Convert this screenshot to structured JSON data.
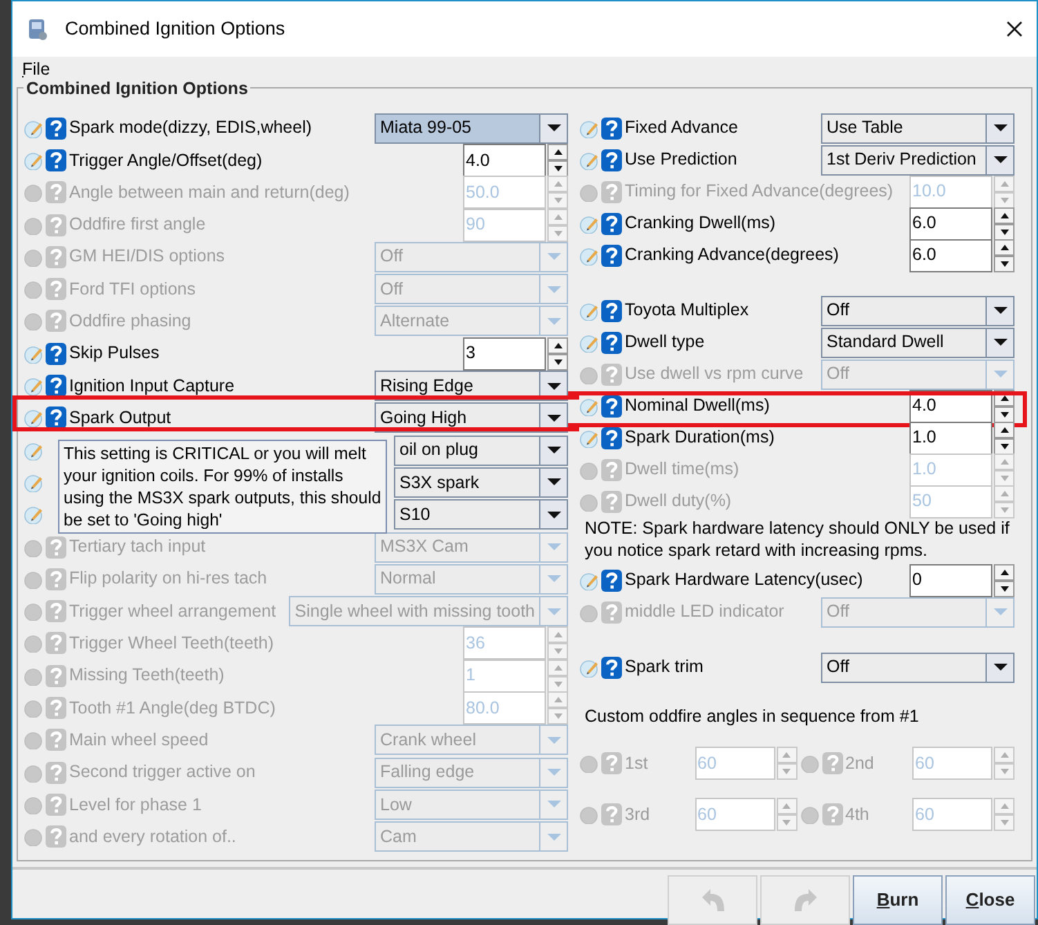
{
  "window": {
    "title": "Combined Ignition Options"
  },
  "menu": [
    {
      "label": "File",
      "underline_first": true
    }
  ],
  "group": {
    "title": "Combined Ignition Options"
  },
  "left_rows": [
    {
      "label": "Spark mode(dizzy, EDIS,wheel)",
      "kind": "combo",
      "value": "Miata 99-05",
      "disabled": false,
      "focused": true,
      "highlighted": false
    },
    {
      "label": "Trigger Angle/Offset(deg)",
      "kind": "spin",
      "value": "4.0",
      "disabled": false,
      "focused": false,
      "highlighted": false
    },
    {
      "label": "Angle between main and return(deg)",
      "kind": "spin",
      "value": "50.0",
      "disabled": true,
      "focused": false,
      "highlighted": false
    },
    {
      "label": "Oddfire first angle",
      "kind": "spin",
      "value": "90",
      "disabled": true,
      "focused": false,
      "highlighted": false
    },
    {
      "label": "GM HEI/DIS options",
      "kind": "combo",
      "value": "Off",
      "disabled": true,
      "focused": false,
      "highlighted": false
    },
    {
      "label": "Ford TFI options",
      "kind": "combo",
      "value": "Off",
      "disabled": true,
      "focused": false,
      "highlighted": false
    },
    {
      "label": "Oddfire phasing",
      "kind": "combo",
      "value": "Alternate",
      "disabled": true,
      "focused": false,
      "highlighted": false
    },
    {
      "label": "Skip Pulses",
      "kind": "spin",
      "value": "3",
      "disabled": false,
      "focused": false,
      "highlighted": false
    },
    {
      "label": "Ignition Input Capture",
      "kind": "combo",
      "value": "Rising Edge",
      "disabled": false,
      "focused": false,
      "highlighted": false
    },
    {
      "label": "Spark Output",
      "kind": "combo",
      "value": "Going High",
      "disabled": false,
      "focused": false,
      "highlighted": true,
      "tooltip": "This setting is CRITICAL or you will melt your ignition coils. For 99% of installs using the MS3X spark outputs, this should be set to 'Going high'"
    },
    {
      "kind": "combo",
      "value": "oil on plug",
      "disabled": false,
      "focused": false,
      "highlighted": false
    },
    {
      "kind": "combo",
      "value": "S3X spark",
      "disabled": false,
      "focused": false,
      "highlighted": false
    },
    {
      "kind": "combo",
      "value": "S10",
      "disabled": false,
      "focused": false,
      "highlighted": false
    },
    {
      "label": "Tertiary tach input",
      "kind": "combo",
      "value": "MS3X Cam",
      "disabled": true,
      "focused": false,
      "highlighted": false
    },
    {
      "label": "Flip polarity on hi-res tach",
      "kind": "combo",
      "value": "Normal",
      "disabled": true,
      "focused": false,
      "highlighted": false
    },
    {
      "label": "Trigger wheel arrangement",
      "kind": "combo",
      "value": "Single wheel with missing tooth",
      "disabled": true,
      "focused": false,
      "highlighted": false
    },
    {
      "label": "Trigger Wheel Teeth(teeth)",
      "kind": "spin",
      "value": "36",
      "disabled": true,
      "focused": false,
      "highlighted": false
    },
    {
      "label": "Missing Teeth(teeth)",
      "kind": "spin",
      "value": "1",
      "disabled": true,
      "focused": false,
      "highlighted": false
    },
    {
      "label": "Tooth #1 Angle(deg BTDC)",
      "kind": "spin",
      "value": "80.0",
      "disabled": true,
      "focused": false,
      "highlighted": false
    },
    {
      "label": "Main wheel speed",
      "kind": "combo",
      "value": "Crank wheel",
      "disabled": true,
      "focused": false,
      "highlighted": false
    },
    {
      "label": "Second trigger active on",
      "kind": "combo",
      "value": "Falling edge",
      "disabled": true,
      "focused": false,
      "highlighted": false
    },
    {
      "label": "Level for phase 1",
      "kind": "combo",
      "value": "Low",
      "disabled": true,
      "focused": false,
      "highlighted": false
    },
    {
      "label": "and every rotation of..",
      "kind": "combo",
      "value": "Cam",
      "disabled": true,
      "focused": false,
      "highlighted": false
    }
  ],
  "right_sections": [
    {
      "items": [
        {
          "label": "Fixed Advance",
          "kind": "combo",
          "value": "Use Table",
          "disabled": false,
          "focused": false,
          "highlighted": false
        },
        {
          "label": "Use Prediction",
          "kind": "combo",
          "value": "1st Deriv Prediction",
          "disabled": false,
          "focused": false,
          "highlighted": false
        },
        {
          "label": "Timing for Fixed Advance(degrees)",
          "kind": "spin",
          "value": "10.0",
          "disabled": true,
          "focused": false,
          "highlighted": false
        },
        {
          "label": "Cranking Dwell(ms)",
          "kind": "spin",
          "value": "6.0",
          "disabled": false,
          "focused": false,
          "highlighted": false
        },
        {
          "label": "Cranking Advance(degrees)",
          "kind": "spin",
          "value": "6.0",
          "disabled": false,
          "focused": false,
          "highlighted": false
        }
      ]
    },
    {
      "items": [
        {
          "label": "Toyota Multiplex",
          "kind": "combo",
          "value": "Off",
          "disabled": false,
          "focused": false,
          "highlighted": false
        },
        {
          "label": "Dwell type",
          "kind": "combo",
          "value": "Standard Dwell",
          "disabled": false,
          "focused": false,
          "highlighted": false
        },
        {
          "label": "Use dwell vs rpm curve",
          "kind": "combo",
          "value": "Off",
          "disabled": true,
          "focused": false,
          "highlighted": false
        },
        {
          "label": "Nominal Dwell(ms)",
          "kind": "spin",
          "value": "4.0",
          "disabled": false,
          "focused": false,
          "highlighted": true
        },
        {
          "label": "Spark Duration(ms)",
          "kind": "spin",
          "value": "1.0",
          "disabled": false,
          "focused": false,
          "highlighted": false
        },
        {
          "label": "Dwell time(ms)",
          "kind": "spin",
          "value": "1.0",
          "disabled": true,
          "focused": false,
          "highlighted": false
        },
        {
          "label": "Dwell duty(%)",
          "kind": "spin",
          "value": "50",
          "disabled": true,
          "focused": false,
          "highlighted": false
        },
        {
          "kind": "note",
          "text": "NOTE: Spark hardware latency should ONLY be used if you notice spark retard with increasing rpms."
        },
        {
          "label": "Spark Hardware Latency(usec)",
          "kind": "spin",
          "value": "0",
          "disabled": false,
          "focused": false,
          "highlighted": false
        },
        {
          "label": "middle LED indicator",
          "kind": "combo",
          "value": "Off",
          "disabled": true,
          "focused": false,
          "highlighted": false
        }
      ]
    },
    {
      "items": [
        {
          "label": "Spark trim",
          "kind": "combo",
          "value": "Off",
          "disabled": false,
          "focused": false,
          "highlighted": false
        }
      ]
    }
  ],
  "oddfire": {
    "heading": "Custom oddfire angles in sequence from #1",
    "items": [
      {
        "label": "1st",
        "value": "60",
        "disabled": true
      },
      {
        "label": "2nd",
        "value": "60",
        "disabled": true
      },
      {
        "label": "3rd",
        "value": "60",
        "disabled": true
      },
      {
        "label": "4th",
        "value": "60",
        "disabled": true
      }
    ]
  },
  "buttons": [
    {
      "kind": "undo",
      "disabled": true
    },
    {
      "kind": "redo",
      "disabled": true
    },
    {
      "kind": "text",
      "label": "Burn",
      "underline_first": true,
      "disabled": false
    },
    {
      "kind": "text",
      "label": "Close",
      "underline_first": true,
      "disabled": false
    }
  ]
}
